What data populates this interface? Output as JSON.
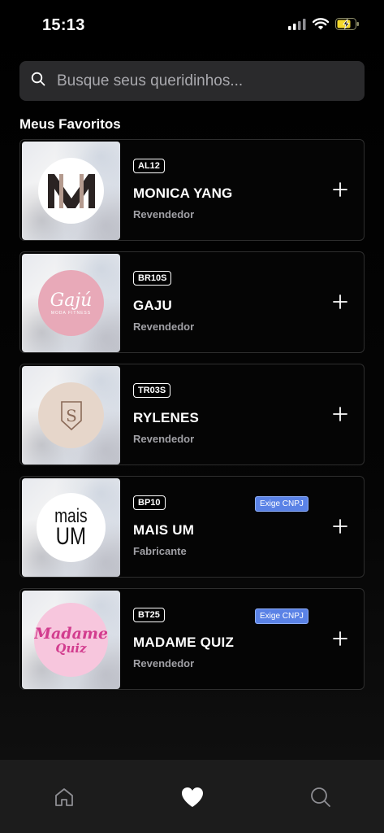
{
  "status_bar": {
    "time": "15:13",
    "icons": [
      "cellular-signal-icon",
      "wifi-icon",
      "battery-charging-icon"
    ]
  },
  "search": {
    "placeholder": "Busque seus queridinhos...",
    "value": "",
    "icon": "search-icon"
  },
  "favorites": {
    "title": "Meus Favoritos",
    "items": [
      {
        "code": "AL12",
        "name": "MONICA YANG",
        "type": "Revendedor",
        "badge": "",
        "logo_text": "M",
        "logo_colors": {
          "bg": "#ffffff",
          "fg": "#2a2322",
          "accent": "#b49a8e"
        }
      },
      {
        "code": "BR10S",
        "name": "GAJU",
        "type": "Revendedor",
        "badge": "",
        "logo_text": "Gajú",
        "logo_subtext": "MODA FITNESS",
        "logo_colors": {
          "bg": "#e8a9b8",
          "fg": "#ffffff"
        }
      },
      {
        "code": "TR03S",
        "name": "RYLENES",
        "type": "Revendedor",
        "badge": "",
        "logo_text": "S",
        "logo_colors": {
          "bg": "#e6d6ca",
          "fg": "#8a6a58"
        }
      },
      {
        "code": "BP10",
        "name": "MAIS UM",
        "type": "Fabricante",
        "badge": "Exige CNPJ",
        "logo_text": "mais",
        "logo_subtext": "UM",
        "logo_colors": {
          "bg": "#ffffff",
          "fg": "#111111"
        }
      },
      {
        "code": "BT25",
        "name": "MADAME QUIZ",
        "type": "Revendedor",
        "badge": "Exige CNPJ",
        "logo_text": "Madame",
        "logo_subtext": "Quiz",
        "logo_colors": {
          "bg": "#f7c6dd",
          "fg": "#d23c8e"
        }
      }
    ]
  },
  "tab_bar": {
    "tabs": [
      {
        "name": "home-icon",
        "active": false
      },
      {
        "name": "heart-icon",
        "active": true
      },
      {
        "name": "search-icon",
        "active": false
      }
    ]
  },
  "colors": {
    "background": "#000000",
    "search_bg": "#2a2a2c",
    "card_border": "#2e2e2e",
    "cnpj_badge": "#5a82e6",
    "tab_bar_bg": "#1c1c1c",
    "muted_text": "#a0a0a5"
  }
}
